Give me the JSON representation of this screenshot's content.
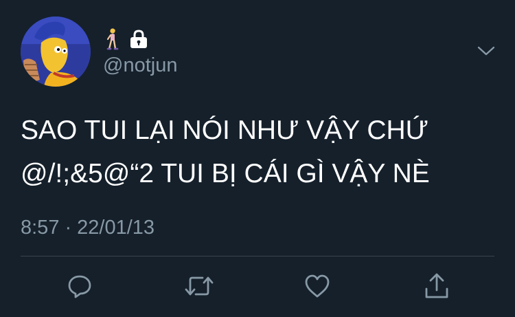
{
  "user": {
    "handle": "@notjun",
    "avatar_icon": "avatar-simpson-cartoon",
    "emoji_icons": [
      "woman-walking-icon",
      "lock-icon"
    ]
  },
  "tweet": {
    "text": "SAO TUI LẠI NÓI NHƯ VẬY CHỨ\n@/!;&5@“2 TUI BỊ CÁI GÌ VẬY NÈ",
    "time": "8:57",
    "separator": "·",
    "date": "22/01/13"
  },
  "actions": [
    {
      "icon": "reply-icon"
    },
    {
      "icon": "retweet-icon"
    },
    {
      "icon": "like-icon"
    },
    {
      "icon": "share-icon"
    }
  ],
  "colors": {
    "background": "#15202b",
    "text_primary": "#ffffff",
    "text_secondary": "#8899a6",
    "divider": "#38444d"
  }
}
